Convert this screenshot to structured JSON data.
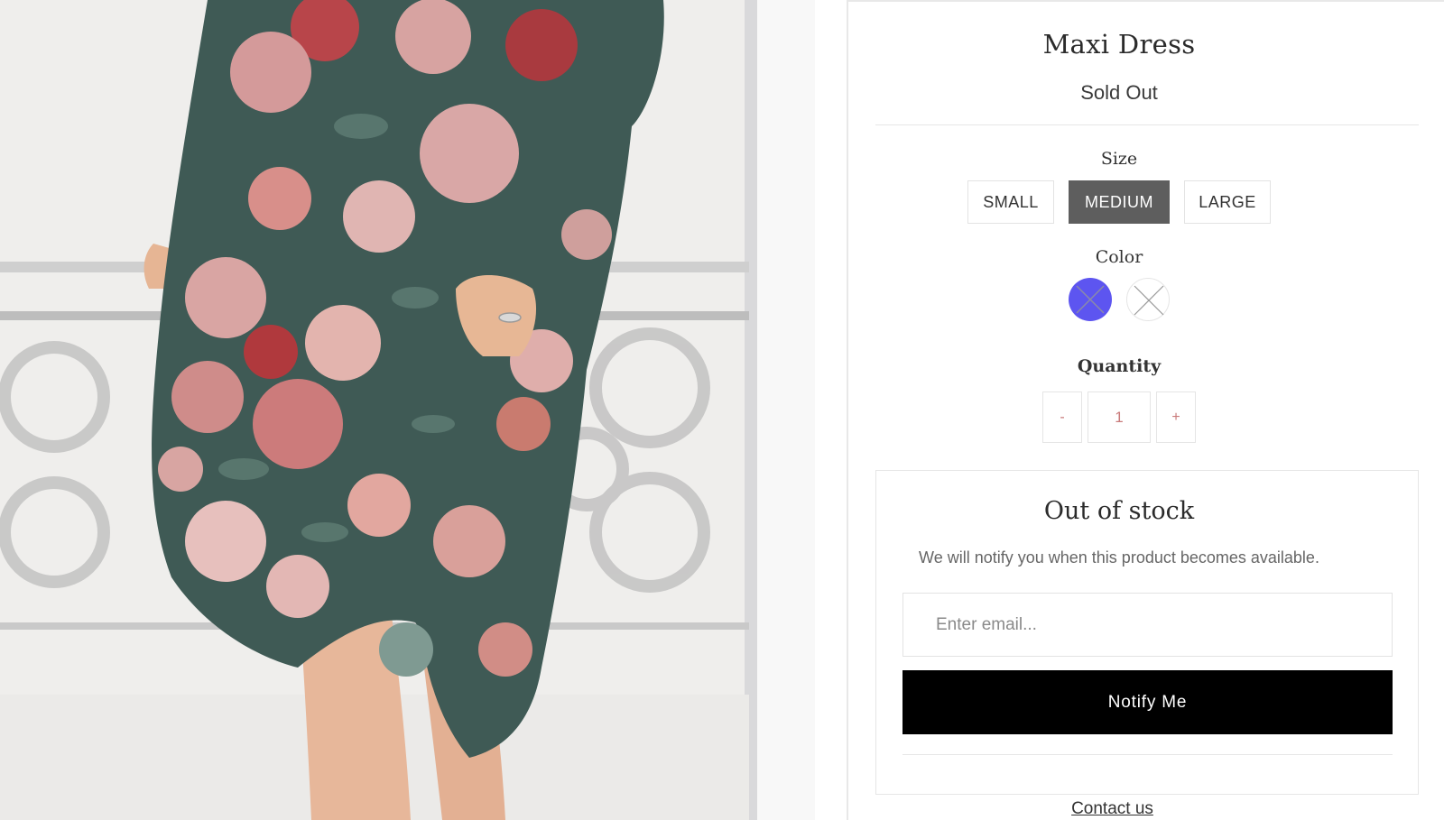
{
  "product": {
    "title": "Maxi Dress",
    "status": "Sold Out"
  },
  "options": {
    "size_label": "Size",
    "sizes": [
      "SMALL",
      "MEDIUM",
      "LARGE"
    ],
    "selected_size": "MEDIUM",
    "color_label": "Color",
    "colors": [
      {
        "name": "blue",
        "hex": "#5d55f0",
        "unavailable": true
      },
      {
        "name": "white",
        "hex": "#ffffff",
        "unavailable": true
      }
    ]
  },
  "quantity": {
    "label": "Quantity",
    "minus": "-",
    "value": "1",
    "plus": "+"
  },
  "out_of_stock": {
    "title": "Out of stock",
    "message": "We will notify you when this product becomes available.",
    "email_placeholder": "Enter email...",
    "button_label": "Notify Me"
  },
  "contact_link": "Contact us",
  "colors": {
    "accent_text": "#c97a7a",
    "button_bg": "#000000",
    "selected_size_bg": "#5e5e5e"
  }
}
